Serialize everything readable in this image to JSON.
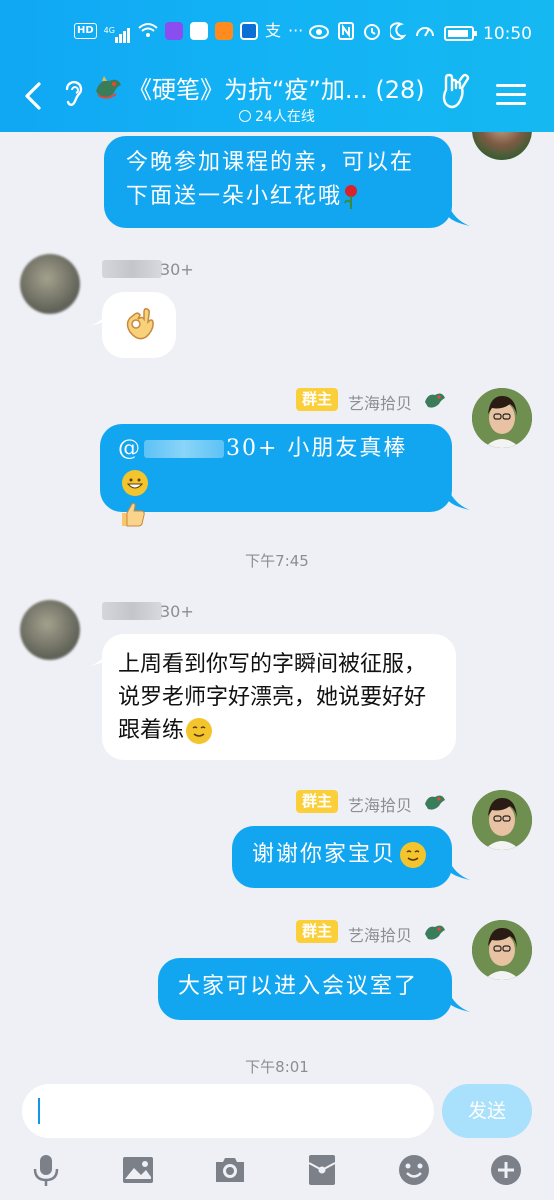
{
  "status_bar": {
    "hd_label": "HD",
    "network_label": "4G",
    "alipay_label": "支",
    "time": "10:50"
  },
  "header": {
    "title": "《硬笔》为抗“疫”加... (28)",
    "online_count": "24人在线"
  },
  "messages": [
    {
      "direction": "out",
      "text": "今晚参加课程的亲，可以在下面送一朵小红花哦"
    },
    {
      "direction": "in",
      "sender_suffix": "30+",
      "emoji": "ok-hand"
    },
    {
      "direction": "out",
      "owner_tag": "群主",
      "sender": "艺海拾贝",
      "text_prefix": "@",
      "text_middle": "30+ 小朋友真棒",
      "emoji": "thumbs-up"
    },
    {
      "type": "time",
      "text": "下午7:45"
    },
    {
      "direction": "in",
      "sender_suffix": "30+",
      "text": "上周看到你写的字瞬间被征服，说罗老师字好漂亮，她说要好好跟着练"
    },
    {
      "direction": "out",
      "owner_tag": "群主",
      "sender": "艺海拾贝",
      "text": "谢谢你家宝贝"
    },
    {
      "direction": "out",
      "owner_tag": "群主",
      "sender": "艺海拾贝",
      "text": "大家可以进入会议室了"
    },
    {
      "type": "time",
      "text": "下午8:01"
    }
  ],
  "input": {
    "placeholder": "",
    "send_label": "发送"
  },
  "toolbar": [
    "mic-icon",
    "image-icon",
    "camera-icon",
    "red-packet-icon",
    "emoji-icon",
    "plus-icon"
  ],
  "colors": {
    "header_blue": "#13b3f5",
    "bubble_blue": "#12a6f1",
    "owner_tag": "#fbcf3a",
    "send_disabled": "#a9e0fb"
  }
}
